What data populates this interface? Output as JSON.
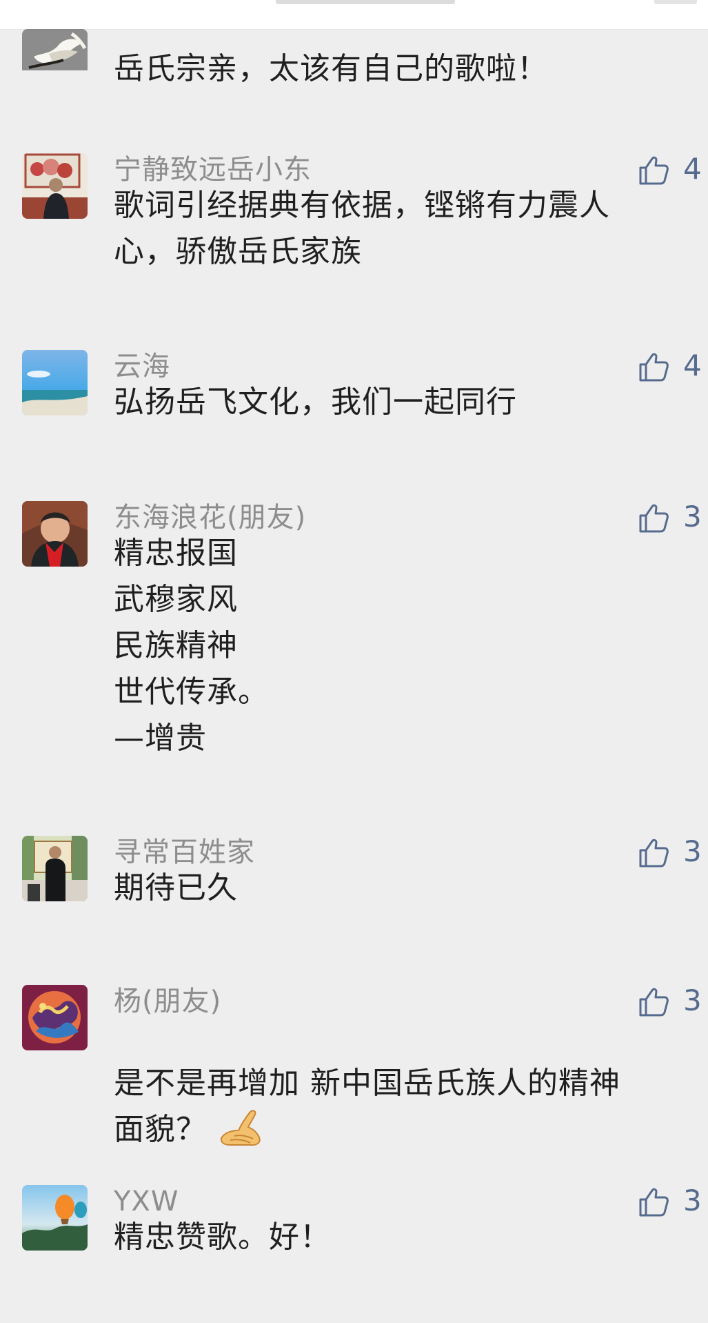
{
  "colors": {
    "page_background": "#efeeee",
    "top_bar": "#ffffff",
    "nickname_text": "#8d8d8d",
    "comment_text": "#1f1f1f",
    "like_accent": "#556b8e"
  },
  "comments": [
    {
      "nickname": "",
      "text": "岳氏宗亲，太该有自己的歌啦！",
      "likes": "",
      "avatar_icon": "white-flower-avatar"
    },
    {
      "nickname": "宁静致远岳小东",
      "text": "歌词引经据典有依据，铿锵有力震人\n心，骄傲岳氏家族",
      "likes": "4",
      "avatar_icon": "man-portrait-avatar"
    },
    {
      "nickname": "云海",
      "text": "弘扬岳飞文化，我们一起同行",
      "likes": "4",
      "avatar_icon": "sea-sky-avatar"
    },
    {
      "nickname": "东海浪花(朋友)",
      "text": "精忠报国\n武穆家风\n民族精神\n世代传承。\n    —增贵",
      "likes": "3",
      "avatar_icon": "red-scarf-portrait-avatar"
    },
    {
      "nickname": "寻常百姓家",
      "text": "期待已久",
      "likes": "3",
      "avatar_icon": "man-in-room-avatar"
    },
    {
      "nickname": "杨(朋友)",
      "text": "是不是再增加 新中国岳氏族人的精神\n面貌？",
      "likes": "3",
      "avatar_icon": "decorative-emblem-avatar",
      "emoji": "pointing-hand-emoji"
    },
    {
      "nickname": "YXW",
      "text": "精忠赞歌。好！",
      "likes": "3",
      "avatar_icon": "hot-air-balloon-avatar"
    }
  ]
}
